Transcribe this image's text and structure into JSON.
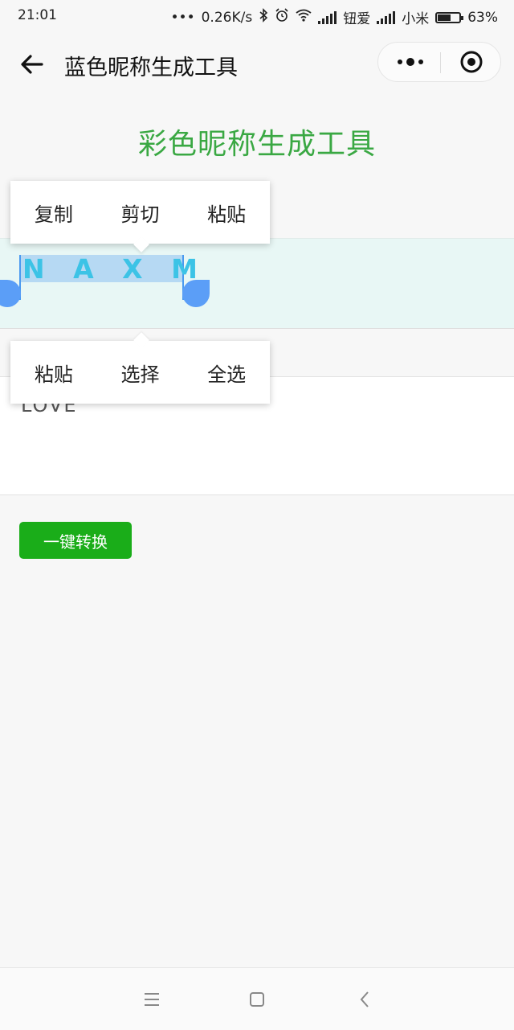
{
  "status_bar": {
    "time": "21:01",
    "speed": "0.26K/s",
    "carrier1": "钮爱",
    "carrier2": "小米",
    "battery": "63%",
    "battery_level": 0.63
  },
  "nav": {
    "title": "蓝色昵称生成工具"
  },
  "page": {
    "title": "彩色昵称生成工具"
  },
  "context_menu_top": {
    "items": [
      "复制",
      "剪切",
      "粘贴"
    ]
  },
  "context_menu_bottom": {
    "items": [
      "粘贴",
      "选择",
      "全选"
    ]
  },
  "output": {
    "text": "N A X M"
  },
  "input": {
    "value": "LOVE"
  },
  "convert_button": {
    "label": "一键转换"
  },
  "colors": {
    "accent_green": "#1aad19",
    "title_green": "#3aa843",
    "output_text": "#3cc3e6",
    "output_bg": "#e8f7f5",
    "selection_handle": "#5b9ef7"
  }
}
